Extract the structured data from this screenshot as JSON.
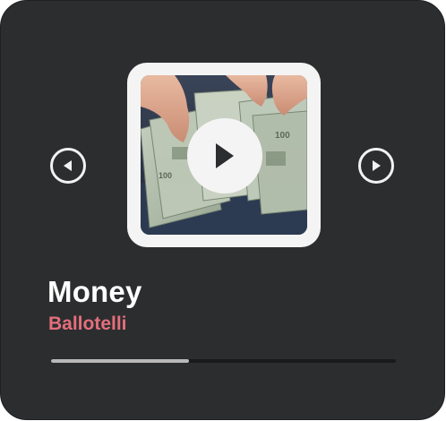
{
  "track": {
    "title": "Money",
    "artist": "Ballotelli"
  },
  "player": {
    "progress_fraction": 0.4,
    "buttons": {
      "prev_icon": "previous-icon",
      "next_icon": "next-icon",
      "play_icon": "play-icon"
    }
  },
  "artwork": {
    "subject": "album-artwork"
  },
  "colors": {
    "card_background": "#2c2d2f",
    "artist_accent": "#e36f7c",
    "title": "#ffffff",
    "progress_fill": "#b9b9b9",
    "progress_track": "#191a1b"
  }
}
